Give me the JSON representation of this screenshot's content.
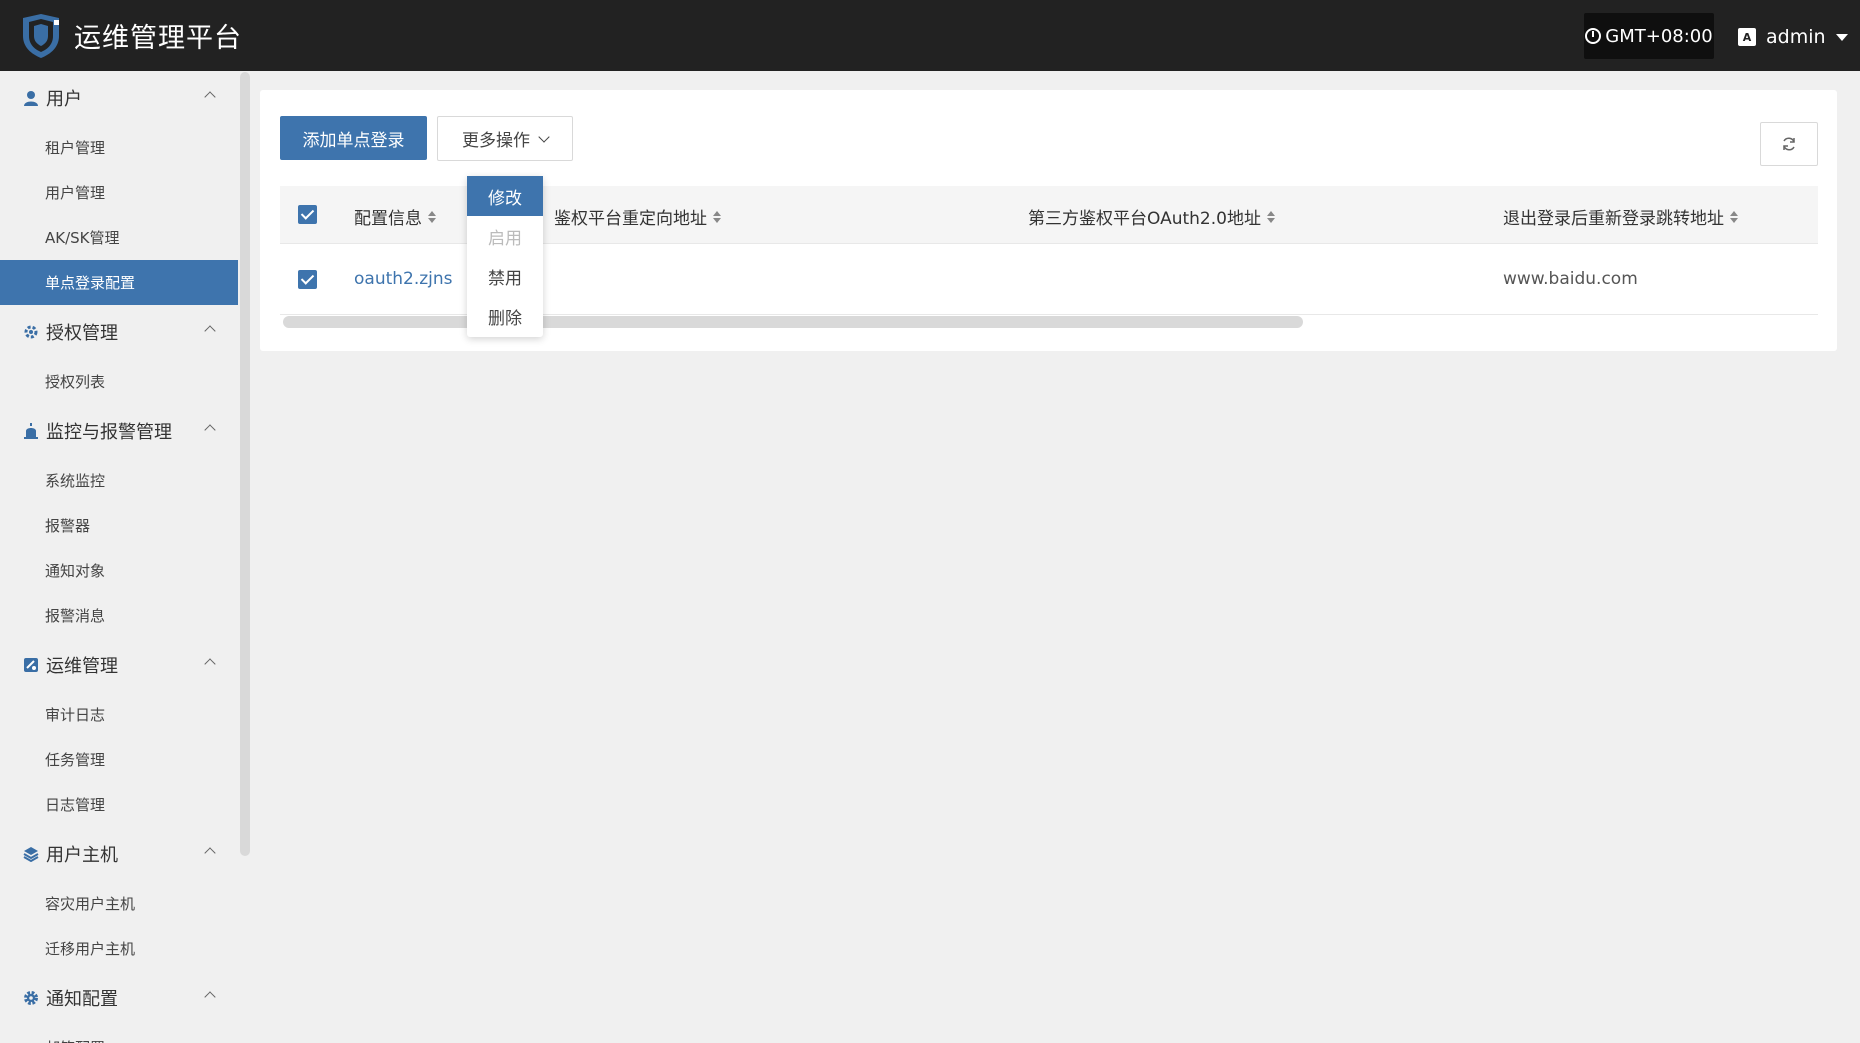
{
  "app": {
    "title": "运维管理平台"
  },
  "header": {
    "timezone": "GMT+08:00",
    "user": "admin",
    "lang_icon": "A"
  },
  "sidebar": {
    "groups": [
      {
        "label": "用户",
        "icon": "user-icon",
        "items": [
          "租户管理",
          "用户管理",
          "AK/SK管理",
          "单点登录配置"
        ],
        "active": "单点登录配置"
      },
      {
        "label": "授权管理",
        "icon": "authorization-icon",
        "items": [
          "授权列表"
        ]
      },
      {
        "label": "监控与报警管理",
        "icon": "alarm-icon",
        "items": [
          "系统监控",
          "报警器",
          "通知对象",
          "报警消息"
        ]
      },
      {
        "label": "运维管理",
        "icon": "ops-icon",
        "items": [
          "审计日志",
          "任务管理",
          "日志管理"
        ]
      },
      {
        "label": "用户主机",
        "icon": "layers-icon",
        "items": [
          "容灾用户主机",
          "迁移用户主机"
        ]
      },
      {
        "label": "通知配置",
        "icon": "gear-icon",
        "items": [
          "邮箱配置"
        ]
      }
    ]
  },
  "toolbar": {
    "add_label": "添加单点登录",
    "more_label": "更多操作"
  },
  "dropdown": {
    "items": [
      "修改",
      "启用",
      "禁用",
      "删除"
    ],
    "highlighted": "修改",
    "disabled": "启用"
  },
  "table": {
    "columns": [
      "配置信息",
      "鉴权平台重定向地址",
      "第三方鉴权平台OAuth2.0地址",
      "退出登录后重新登录跳转地址"
    ],
    "rows": [
      {
        "config": "oauth2.zjns",
        "redirect": "",
        "oauth": "",
        "relogin": "www.baidu.com"
      }
    ]
  },
  "colors": {
    "accent": "#3e74ad",
    "header_bg": "#222222"
  }
}
